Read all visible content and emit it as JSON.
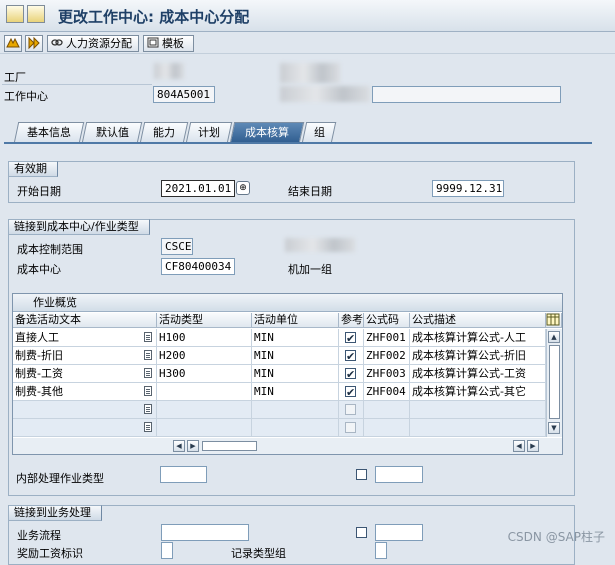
{
  "window": {
    "title": "更改工作中心: 成本中心分配"
  },
  "toolbar": {
    "hr_assign_label": "人力资源分配",
    "template_label": "模板"
  },
  "header": {
    "plant_label": "工厂",
    "workcenter_label": "工作中心",
    "workcenter_value": "804A5001"
  },
  "tabs": [
    {
      "label": "基本信息",
      "active": false
    },
    {
      "label": "默认值",
      "active": false
    },
    {
      "label": "能力",
      "active": false
    },
    {
      "label": "计划",
      "active": false
    },
    {
      "label": "成本核算",
      "active": true
    },
    {
      "label": "组",
      "active": false
    }
  ],
  "validity": {
    "title": "有效期",
    "start_label": "开始日期",
    "start_value": "2021.01.01",
    "end_label": "结束日期",
    "end_value": "9999.12.31"
  },
  "link_cc": {
    "title": "链接到成本中心/作业类型",
    "ca_label": "成本控制范围",
    "ca_value": "CSCE",
    "cc_label": "成本中心",
    "cc_value": "CF80400034",
    "cc_desc": "机加一组"
  },
  "activity_table": {
    "caption": "作业概览",
    "columns": [
      "备选活动文本",
      "活动类型",
      "活动单位",
      "参考",
      "公式码",
      "公式描述"
    ],
    "rows": [
      {
        "text": "直接人工",
        "type": "H100",
        "unit": "MIN",
        "ref": true,
        "formula": "ZHF001",
        "desc": "成本核算计算公式-人工"
      },
      {
        "text": "制费-折旧",
        "type": "H200",
        "unit": "MIN",
        "ref": true,
        "formula": "ZHF002",
        "desc": "成本核算计算公式-折旧"
      },
      {
        "text": "制费-工资",
        "type": "H300",
        "unit": "MIN",
        "ref": true,
        "formula": "ZHF003",
        "desc": "成本核算计算公式-工资"
      },
      {
        "text": "制费-其他",
        "type": "",
        "unit": "MIN",
        "ref": true,
        "formula": "ZHF004",
        "desc": "成本核算计算公式-其它"
      },
      {
        "text": "",
        "type": "",
        "unit": "",
        "ref": false,
        "formula": "",
        "desc": ""
      },
      {
        "text": "",
        "type": "",
        "unit": "",
        "ref": false,
        "formula": "",
        "desc": ""
      }
    ]
  },
  "internal": {
    "label": "内部处理作业类型"
  },
  "link_bp": {
    "title": "链接到业务处理",
    "process_label": "业务流程",
    "incentive_label": "奖励工资标识",
    "record_type_label": "记录类型组"
  },
  "watermark": "CSDN @SAP柱子"
}
